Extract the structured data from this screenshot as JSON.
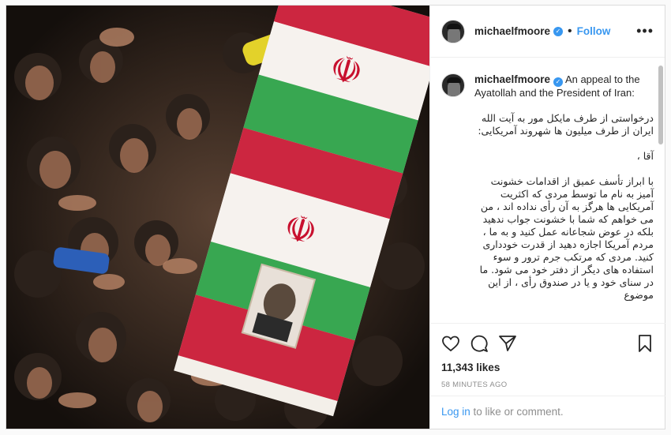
{
  "post": {
    "username": "michaelfmoore",
    "follow_label": "Follow",
    "separator": "•",
    "more_label": "•••",
    "verified_glyph": "✓",
    "caption_en": "An appeal to the Ayatollah and the President of Iran:",
    "caption_fa_1": "درخواستی از طرف مایکل مور به آیت الله ایران از طرف میلیون ها شهروند آمریکایی:",
    "caption_fa_2": "آقا ،",
    "caption_fa_3": "با ابراز تأسف عمیق از اقدامات خشونت آمیز به نام ما توسط مردی که اکثریت آمریکایی ها هرگز به آن رأی نداده اند ، من می خواهم که شما با خشونت جواب ندهید بلکه در عوض شجاعانه عمل کنید و به ما ، مردم آمریکا اجازه دهید از قدرت خودداری کنید. مردی که مرتکب جرم ترور و سوء استفاده های دیگر از دفتر خود می شود. ما در سنای خود و یا در صندوق رأی ، از این موضوع",
    "likes": "11,343 likes",
    "time": "58 MINUTES AGO",
    "login_link": "Log in",
    "login_rest": " to like or comment."
  },
  "icons": {
    "like": "heart-icon",
    "comment": "comment-icon",
    "share": "share-icon",
    "save": "bookmark-icon"
  },
  "colors": {
    "link_blue": "#3897f0",
    "flag_red": "#c8102e",
    "flag_green": "#239f40"
  }
}
